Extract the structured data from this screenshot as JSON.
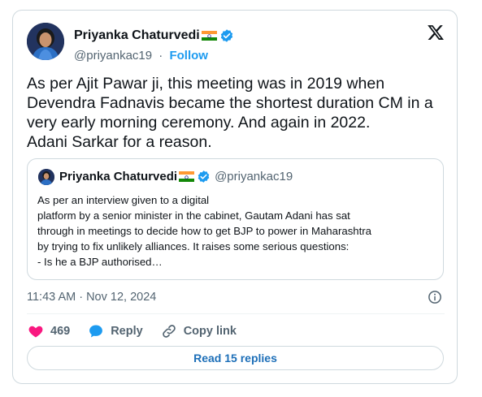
{
  "author": {
    "name": "Priyanka Chaturvedi",
    "handle": "@priyankac19",
    "separator": "·",
    "follow_label": "Follow"
  },
  "tweet": {
    "text": "As per Ajit Pawar ji, this meeting was in 2019 when\nDevendra Fadnavis became the shortest duration CM in a\nvery early morning ceremony. And again in 2022.\nAdani Sarkar for a reason.",
    "timestamp": "11:43 AM · Nov 12, 2024"
  },
  "quoted": {
    "name": "Priyanka Chaturvedi",
    "handle": "@priyankac19",
    "text": "As per an interview given to a digital\nplatform by a senior minister in the cabinet,  Gautam Adani has sat\nthrough in meetings to decide how to get BJP to power in Maharashtra\nby trying to fix unlikely alliances. It raises some serious questions:\n- Is he a BJP authorised…"
  },
  "actions": {
    "likes": "469",
    "reply_label": "Reply",
    "copy_link_label": "Copy link"
  },
  "replies_button": "Read 15 replies",
  "colors": {
    "accent": "#1d9bf0",
    "like": "#f91880",
    "verified": "#1d9bf0",
    "flag_saffron": "#ff9933",
    "flag_green": "#138808"
  },
  "icons": [
    "verified-badge-icon",
    "x-logo-icon",
    "info-icon",
    "heart-icon",
    "reply-bubble-icon",
    "link-icon",
    "india-flag-icon"
  ]
}
